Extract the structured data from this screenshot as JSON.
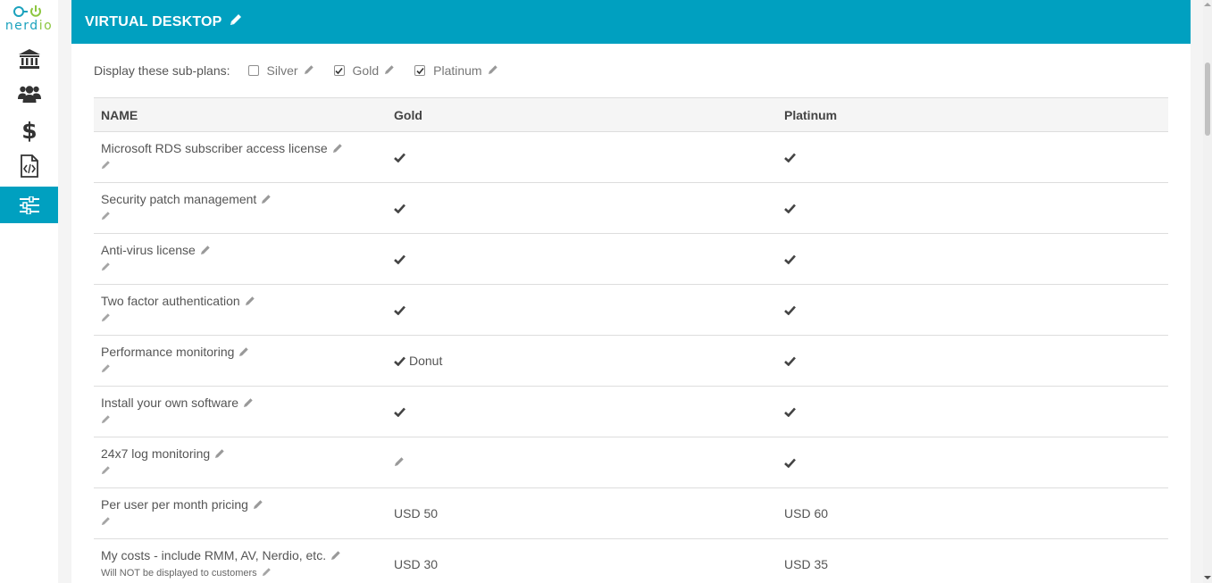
{
  "brand": {
    "logo_text_main": "nerd",
    "logo_text_accent": "io",
    "primary_color": "#00a0c0",
    "accent_color": "#8cc63f"
  },
  "sidebar": {
    "items": [
      {
        "icon": "bank-icon",
        "active": false
      },
      {
        "icon": "users-icon",
        "active": false
      },
      {
        "icon": "dollar-icon",
        "active": false
      },
      {
        "icon": "code-file-icon",
        "active": false
      },
      {
        "icon": "sliders-icon",
        "active": true
      }
    ]
  },
  "panel": {
    "title": "VIRTUAL DESKTOP"
  },
  "subplans": {
    "label": "Display these sub-plans:",
    "options": [
      {
        "name": "Silver",
        "checked": false
      },
      {
        "name": "Gold",
        "checked": true
      },
      {
        "name": "Platinum",
        "checked": true
      }
    ]
  },
  "table": {
    "columns": [
      "NAME",
      "Gold",
      "Platinum"
    ],
    "rows": [
      {
        "name": "Microsoft RDS subscriber access license",
        "gold": "check",
        "gold_text": "",
        "platinum": "check",
        "platinum_text": ""
      },
      {
        "name": "Security patch management",
        "gold": "check",
        "gold_text": "",
        "platinum": "check",
        "platinum_text": ""
      },
      {
        "name": "Anti-virus license",
        "gold": "check",
        "gold_text": "",
        "platinum": "check",
        "platinum_text": ""
      },
      {
        "name": "Two factor authentication",
        "gold": "check",
        "gold_text": "",
        "platinum": "check",
        "platinum_text": ""
      },
      {
        "name": "Performance monitoring",
        "gold": "check",
        "gold_text": "Donut",
        "platinum": "check",
        "platinum_text": ""
      },
      {
        "name": "Install your own software",
        "gold": "check",
        "gold_text": "",
        "platinum": "check",
        "platinum_text": ""
      },
      {
        "name": "24x7 log monitoring",
        "gold": "pencil",
        "gold_text": "",
        "platinum": "check",
        "platinum_text": ""
      },
      {
        "name": "Per user per month pricing",
        "gold": "text",
        "gold_text": "USD 50",
        "platinum": "text",
        "platinum_text": "USD 60"
      },
      {
        "name": "My costs - include RMM, AV, Nerdio, etc.",
        "note": "Will NOT be displayed to customers",
        "gold": "text",
        "gold_text": "USD 30",
        "platinum": "text",
        "platinum_text": "USD 35"
      }
    ]
  }
}
